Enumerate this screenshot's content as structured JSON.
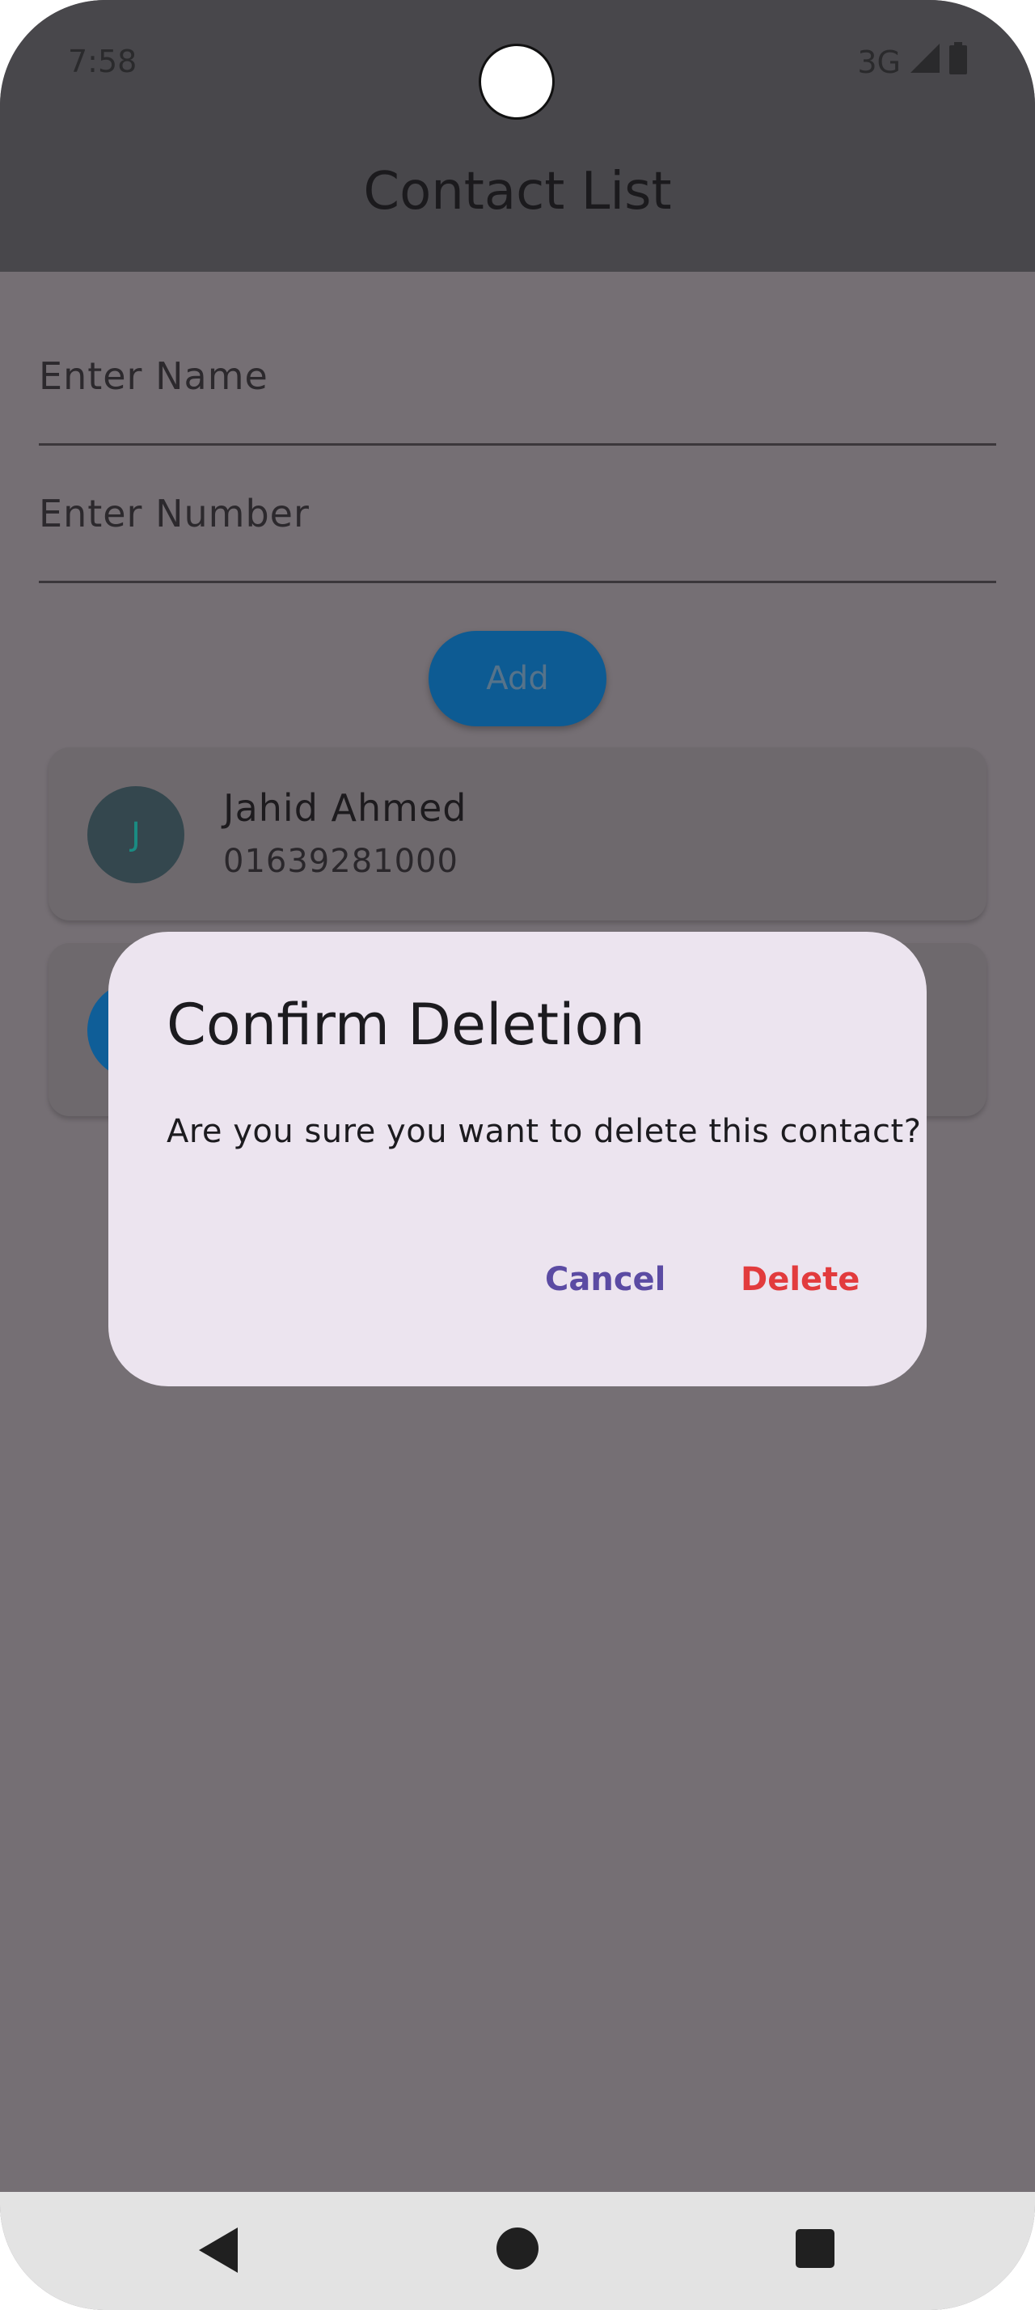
{
  "status_bar": {
    "time": "7:58",
    "network": "3G"
  },
  "app_bar": {
    "title": "Contact List"
  },
  "form": {
    "name_placeholder": "Enter Name",
    "number_placeholder": "Enter Number",
    "add_label": "Add"
  },
  "contacts": [
    {
      "initial": "J",
      "name": "Jahid Ahmed",
      "number": "01639281000"
    }
  ],
  "dialog": {
    "title": "Confirm Deletion",
    "message": "Are you sure you want to delete this contact?",
    "cancel_label": "Cancel",
    "delete_label": "Delete"
  },
  "colors": {
    "accent_primary": "#5b4ba3",
    "danger": "#e23b3d",
    "button_blue": "#0d5b93"
  },
  "icons": [
    "signal-icon",
    "battery-icon",
    "back-icon",
    "home-icon",
    "recents-icon"
  ]
}
